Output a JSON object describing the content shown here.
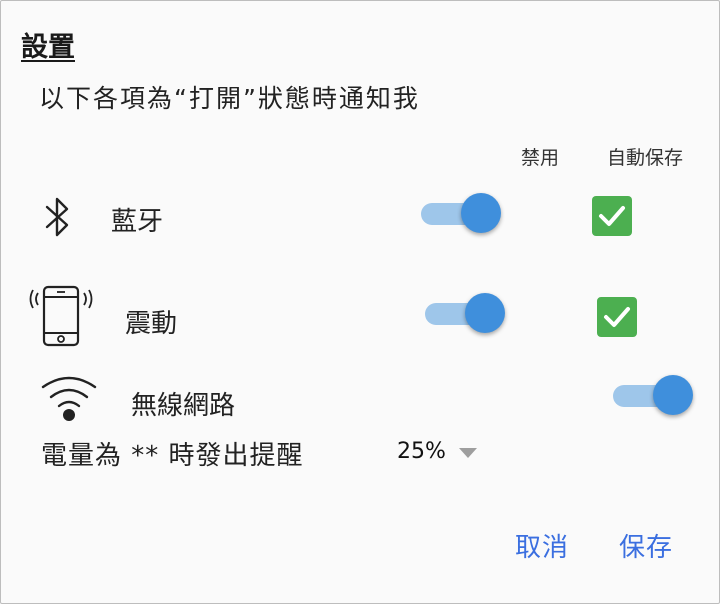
{
  "dialog": {
    "title": "設置",
    "subtitle": "以下各項為“打開”狀態時通知我",
    "columns": {
      "disable": "禁用",
      "autosave": "自動保存"
    },
    "rows": [
      {
        "label": "藍牙",
        "icon": "bluetooth-icon",
        "toggle_on": true,
        "autosave_checked": true
      },
      {
        "label": "震動",
        "icon": "vibrate-phone-icon",
        "toggle_on": true,
        "autosave_checked": true
      },
      {
        "label": "無線網路",
        "icon": "wifi-icon",
        "toggle_on": true
      }
    ],
    "battery": {
      "label": "電量為 ** 時發出提醒",
      "value": "25%"
    },
    "actions": {
      "cancel": "取消",
      "save": "保存"
    }
  },
  "colors": {
    "accent": "#3f8fdc",
    "track": "#9ec6ea",
    "checkbox": "#4caf50",
    "link": "#3b6fe0"
  }
}
